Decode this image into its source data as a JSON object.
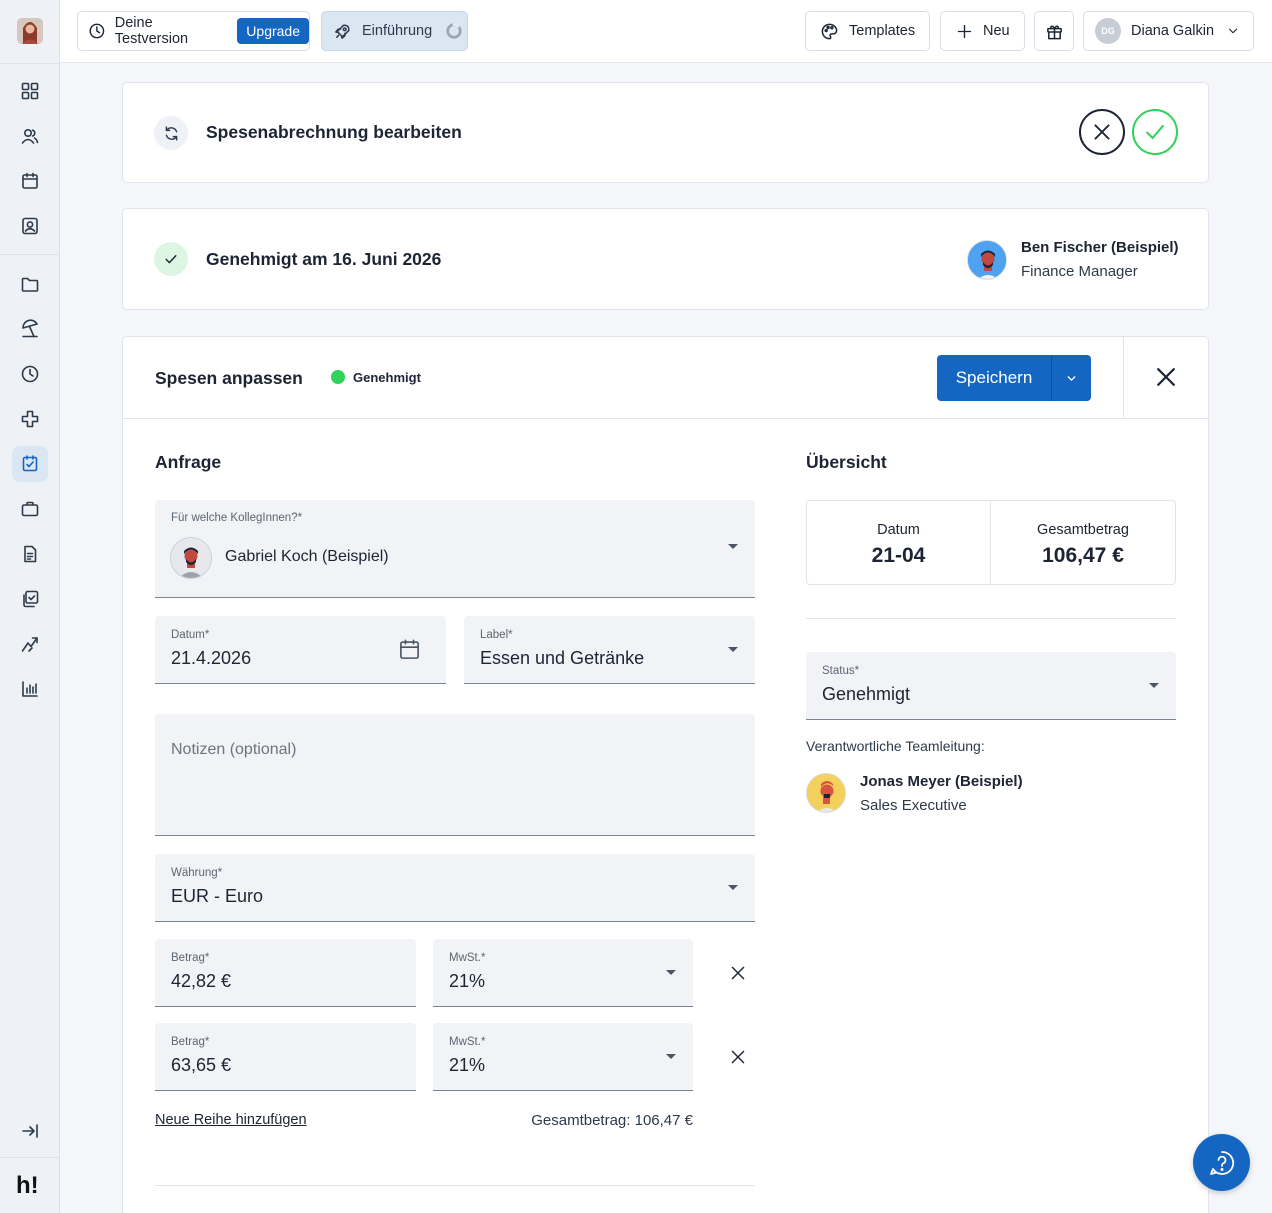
{
  "colors": {
    "accent": "#1466c2",
    "success": "#2fd25a",
    "active_bg": "#dbe6f3"
  },
  "topbar": {
    "trial_label": "Deine Testversion",
    "upgrade_label": "Upgrade",
    "intro_label": "Einführung",
    "templates_label": "Templates",
    "new_label": "Neu",
    "user_initials": "DG",
    "user_name": "Diana Galkin"
  },
  "sidebar": {
    "items": [
      "dashboard-icon",
      "people-icon",
      "calendar-icon",
      "contact-card-icon",
      "folder-icon",
      "beach-umbrella-icon",
      "clock-icon",
      "medical-cross-icon",
      "expense-check-icon",
      "briefcase-icon",
      "document-icon",
      "copy-check-icon",
      "trend-icon",
      "bar-chart-icon"
    ],
    "active": "expense-check-icon",
    "logo": "h!"
  },
  "header_card": {
    "title": "Spesenabrechnung bearbeiten"
  },
  "approval_card": {
    "text": "Genehmigt am 16. Juni 2026",
    "approver_name": "Ben Fischer (Beispiel)",
    "approver_role": "Finance Manager"
  },
  "form": {
    "title": "Spesen anpassen",
    "status_badge": "Genehmigt",
    "save_label": "Speichern",
    "request_heading": "Anfrage",
    "colleague": {
      "label": "Für welche KollegInnen?*",
      "value": "Gabriel Koch (Beispiel)"
    },
    "date": {
      "label": "Datum*",
      "value": "21.4.2026"
    },
    "label_field": {
      "label": "Label*",
      "value": "Essen und Getränke"
    },
    "notes": {
      "placeholder": "Notizen (optional)"
    },
    "currency": {
      "label": "Währung*",
      "value": "EUR - Euro"
    },
    "rows": [
      {
        "amount_label": "Betrag*",
        "amount": "42,82 €",
        "vat_label": "MwSt.*",
        "vat": "21%"
      },
      {
        "amount_label": "Betrag*",
        "amount": "63,65 €",
        "vat_label": "MwSt.*",
        "vat": "21%"
      }
    ],
    "add_row_label": "Neue Reihe hinzufügen",
    "total_text": "Gesamtbetrag: 106,47 €"
  },
  "overview": {
    "heading": "Übersicht",
    "date_label": "Datum",
    "date_value": "21-04",
    "total_label": "Gesamtbetrag",
    "total_value": "106,47 €",
    "status_label": "Status*",
    "status_value": "Genehmigt",
    "lead_label": "Verantwortliche Teamleitung:",
    "lead_name": "Jonas Meyer (Beispiel)",
    "lead_role": "Sales Executive"
  }
}
